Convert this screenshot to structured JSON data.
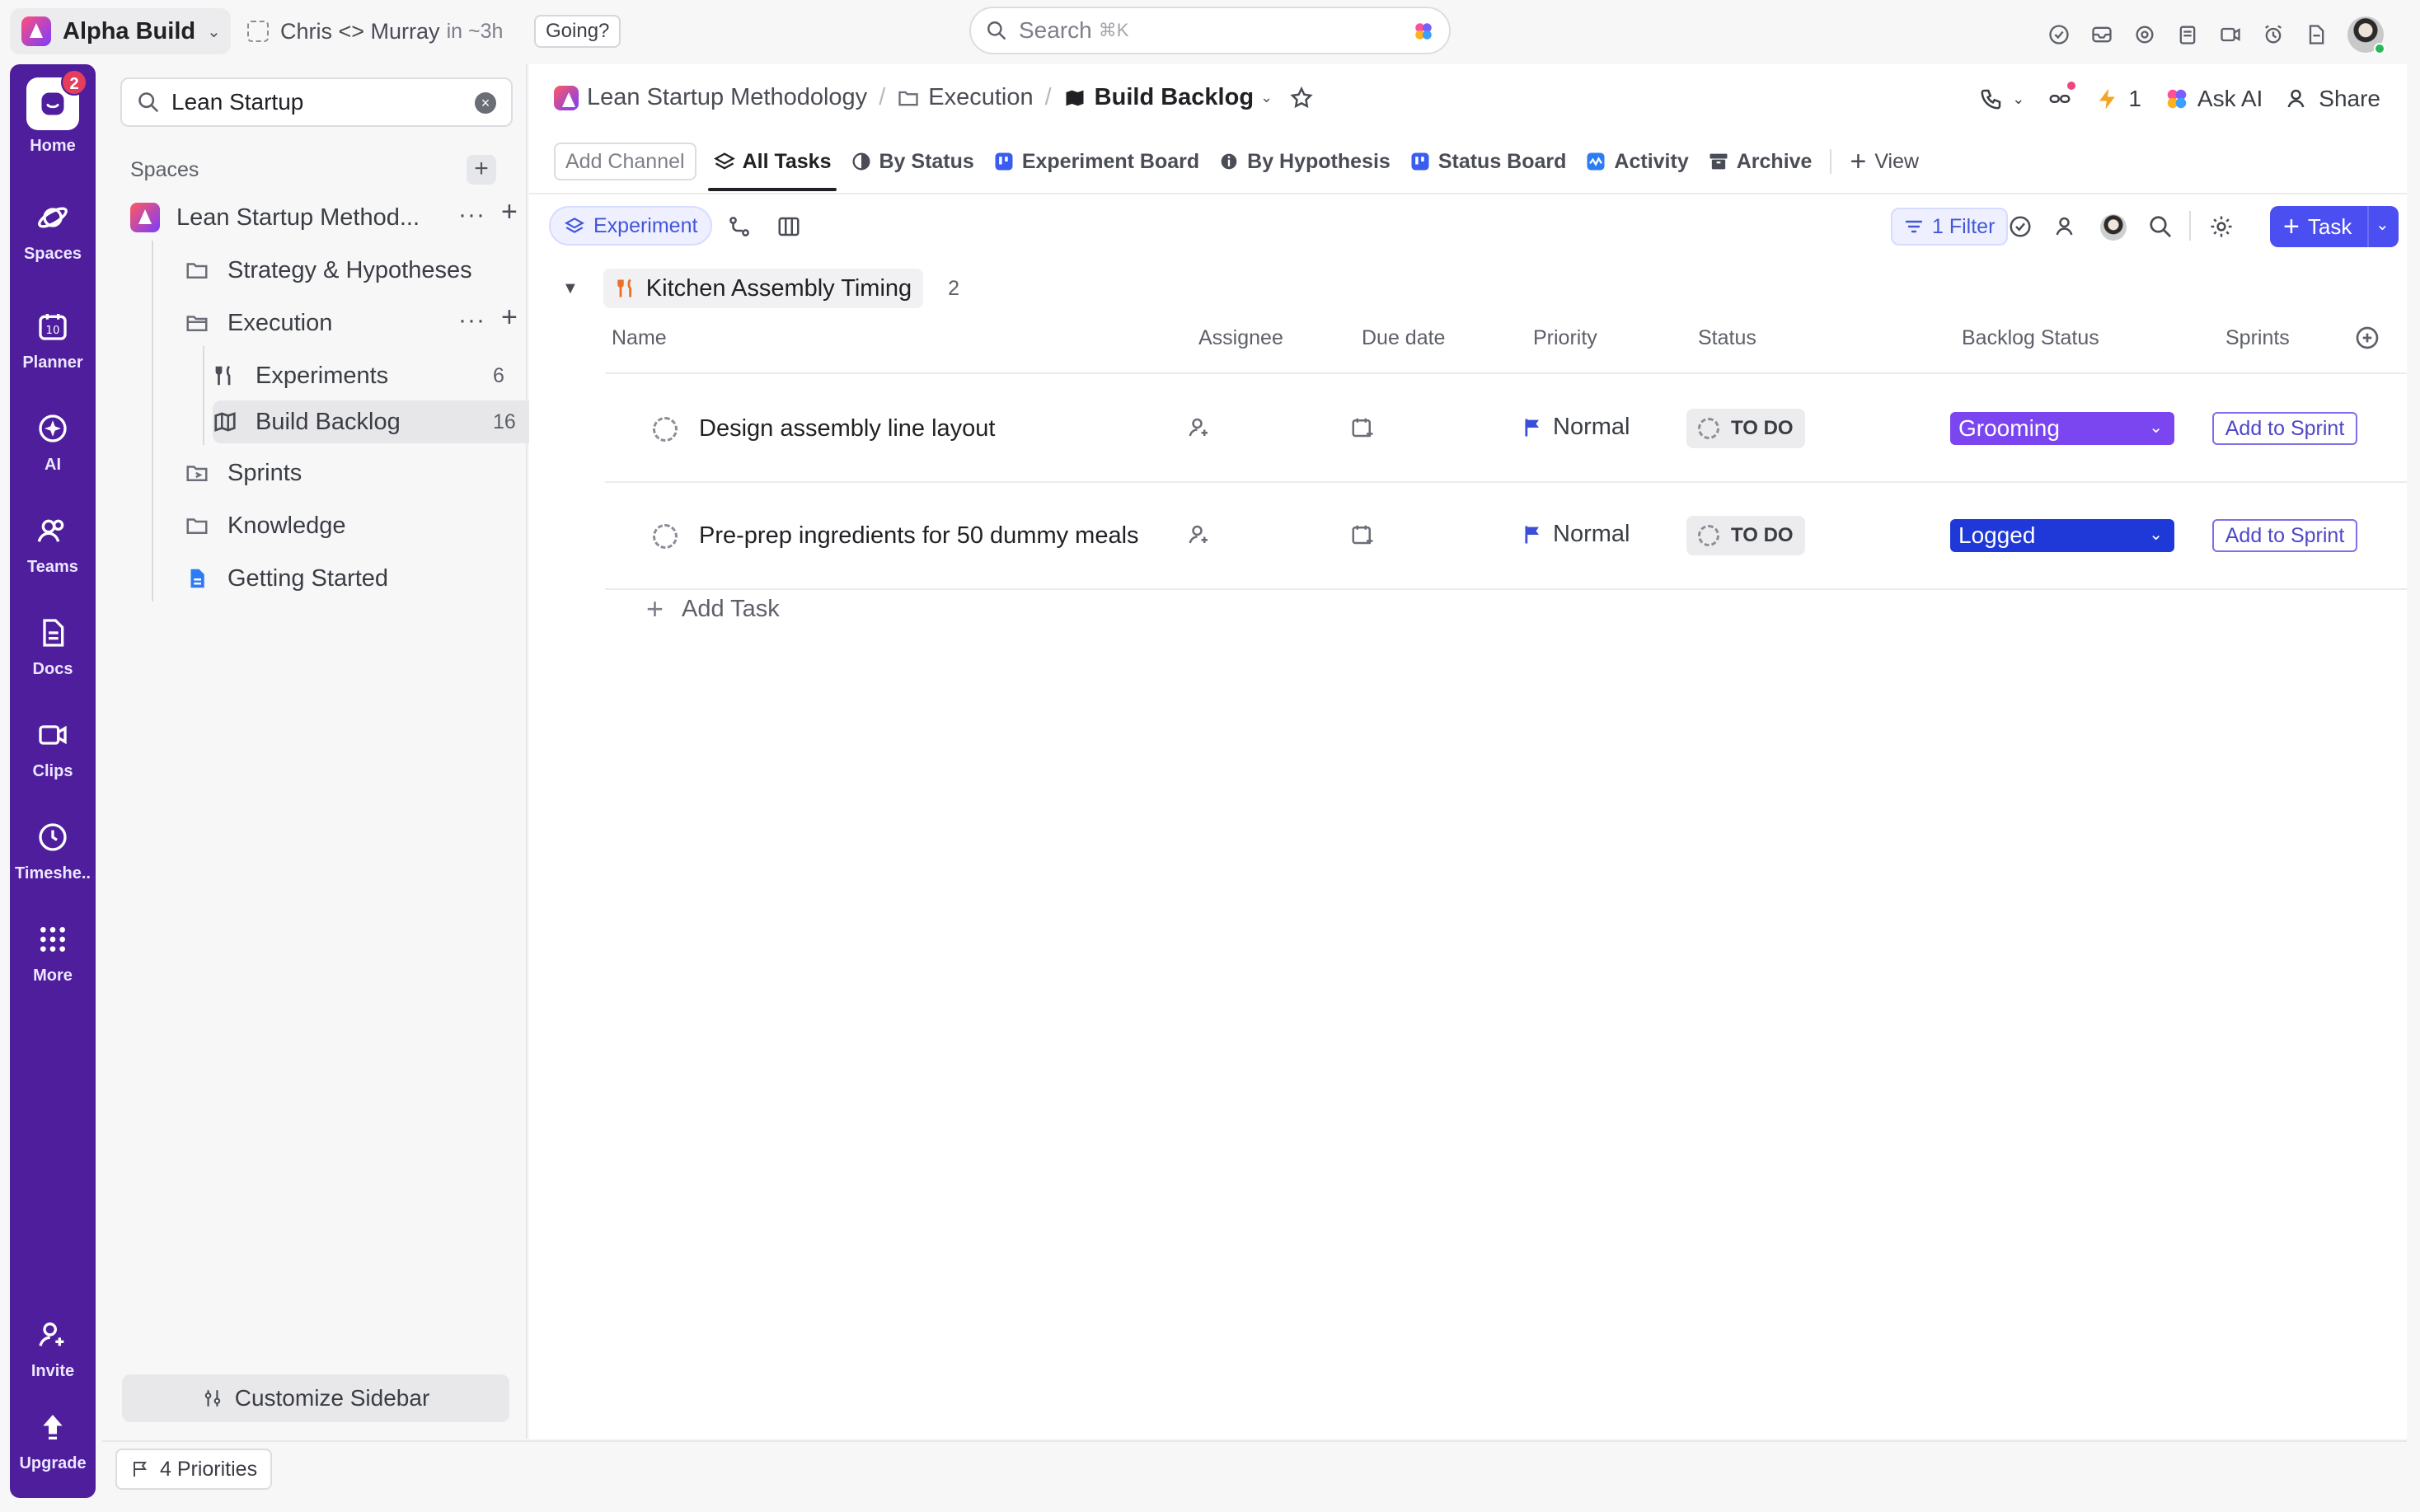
{
  "topbar": {
    "workspace_name": "Alpha Build",
    "meeting_title": "Chris <> Murray",
    "meeting_time": "in ~3h",
    "going_label": "Going?",
    "search_placeholder": "Search",
    "search_shortcut": "⌘K"
  },
  "rail": {
    "home_badge": "2",
    "items": [
      {
        "label": "Home",
        "icon": "home-icon"
      },
      {
        "label": "Spaces",
        "icon": "planet-icon"
      },
      {
        "label": "Planner",
        "icon": "calendar-icon"
      },
      {
        "label": "AI",
        "icon": "ai-icon"
      },
      {
        "label": "Teams",
        "icon": "teams-icon"
      },
      {
        "label": "Docs",
        "icon": "doc-icon"
      },
      {
        "label": "Clips",
        "icon": "video-icon"
      },
      {
        "label": "Timeshe..",
        "icon": "clock-icon"
      },
      {
        "label": "More",
        "icon": "grid-icon"
      },
      {
        "label": "Invite",
        "icon": "user-plus-icon"
      },
      {
        "label": "Upgrade",
        "icon": "upgrade-icon"
      }
    ]
  },
  "sidebar": {
    "search_value": "Lean Startup",
    "spaces_heading": "Spaces",
    "space_name": "Lean Startup Method...",
    "folders": {
      "strategy": "Strategy & Hypotheses",
      "execution": "Execution",
      "experiments": "Experiments",
      "experiments_count": "6",
      "build_backlog": "Build Backlog",
      "build_backlog_count": "16",
      "sprints": "Sprints",
      "knowledge": "Knowledge",
      "getting_started": "Getting Started"
    },
    "customize_label": "Customize Sidebar"
  },
  "header": {
    "breadcrumb": [
      "Lean Startup Methodology",
      "Execution",
      "Build Backlog"
    ],
    "notif_count": "1",
    "ask_ai": "Ask AI",
    "share": "Share"
  },
  "views": {
    "add_channel": "Add Channel",
    "tabs": [
      "All Tasks",
      "By Status",
      "Experiment Board",
      "By Hypothesis",
      "Status Board",
      "Activity",
      "Archive"
    ],
    "add_view": "View"
  },
  "toolbar": {
    "group_chip": "Experiment",
    "filter_label": "1 Filter",
    "task_button": "Task"
  },
  "group": {
    "name": "Kitchen Assembly Timing",
    "count": "2"
  },
  "columns": [
    "Name",
    "Assignee",
    "Due date",
    "Priority",
    "Status",
    "Backlog Status",
    "Sprints"
  ],
  "tasks": [
    {
      "name": "Design assembly line layout",
      "priority": "Normal",
      "status": "TO DO",
      "backlog_status": "Grooming",
      "backlog_color": "#7b45f0",
      "sprint": "Add to Sprint"
    },
    {
      "name": "Pre-prep ingredients for 50 dummy meals",
      "priority": "Normal",
      "status": "TO DO",
      "backlog_status": "Logged",
      "backlog_color": "#1f38d8",
      "sprint": "Add to Sprint"
    }
  ],
  "add_task_label": "Add Task",
  "bottom": {
    "priorities_label": "4 Priorities"
  }
}
